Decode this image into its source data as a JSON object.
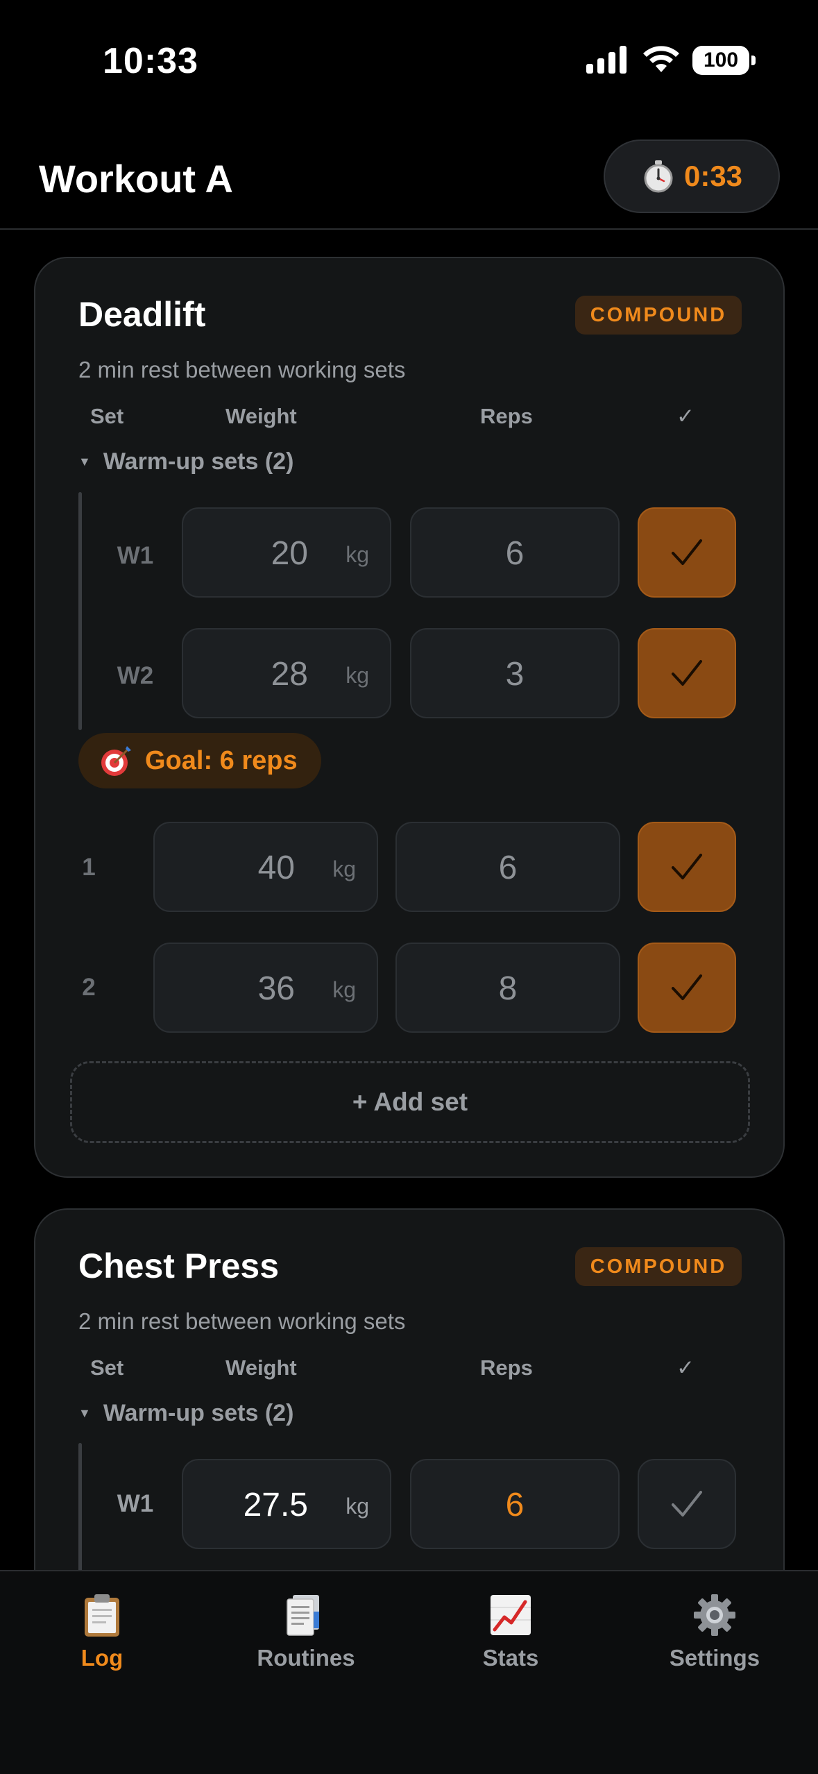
{
  "status_bar": {
    "time": "10:33",
    "battery": "100"
  },
  "header": {
    "title": "Workout A",
    "timer": "0:33"
  },
  "columns": {
    "set": "Set",
    "weight": "Weight",
    "reps": "Reps",
    "done": "✓"
  },
  "exercises": [
    {
      "name": "Deadlift",
      "tag": "COMPOUND",
      "rest": "2 min rest between working sets",
      "warmup_label": "Warm-up sets (2)",
      "warmup_sets": [
        {
          "label": "W1",
          "weight": "20",
          "unit": "kg",
          "reps": "6",
          "done": true
        },
        {
          "label": "W2",
          "weight": "28",
          "unit": "kg",
          "reps": "3",
          "done": true
        }
      ],
      "goal": "Goal: 6 reps",
      "working_sets": [
        {
          "label": "1",
          "weight": "40",
          "unit": "kg",
          "reps": "6",
          "done": true
        },
        {
          "label": "2",
          "weight": "36",
          "unit": "kg",
          "reps": "8",
          "done": true
        }
      ],
      "add_set": "+ Add set"
    },
    {
      "name": "Chest Press",
      "tag": "COMPOUND",
      "rest": "2 min rest between working sets",
      "warmup_label": "Warm-up sets (2)",
      "warmup_sets": [
        {
          "label": "W1",
          "weight": "27.5",
          "unit": "kg",
          "reps": "6",
          "done": false
        }
      ]
    }
  ],
  "tabs": [
    {
      "label": "Log",
      "icon": "clipboard-icon",
      "active": true
    },
    {
      "label": "Routines",
      "icon": "document-icon",
      "active": false
    },
    {
      "label": "Stats",
      "icon": "chart-icon",
      "active": false
    },
    {
      "label": "Settings",
      "icon": "gear-icon",
      "active": false
    }
  ],
  "colors": {
    "accent": "#f08a1c",
    "check_done": "#8a4a13",
    "background": "#000000",
    "card": "#141617"
  }
}
